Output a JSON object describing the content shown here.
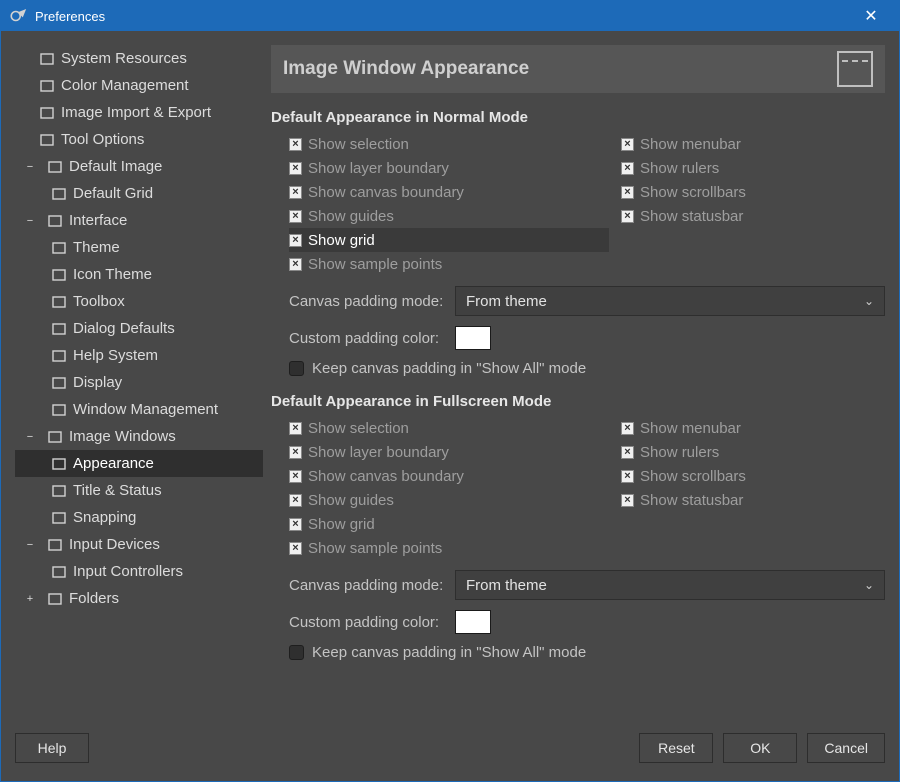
{
  "window": {
    "title": "Preferences"
  },
  "sidebar": {
    "items": [
      {
        "label": "System Resources",
        "depth": 0,
        "exp": ""
      },
      {
        "label": "Color Management",
        "depth": 0,
        "exp": ""
      },
      {
        "label": "Image Import & Export",
        "depth": 0,
        "exp": ""
      },
      {
        "label": "Tool Options",
        "depth": 0,
        "exp": ""
      },
      {
        "label": "Default Image",
        "depth": 1,
        "exp": "−"
      },
      {
        "label": "Default Grid",
        "depth": 2,
        "exp": ""
      },
      {
        "label": "Interface",
        "depth": 1,
        "exp": "−"
      },
      {
        "label": "Theme",
        "depth": 2,
        "exp": ""
      },
      {
        "label": "Icon Theme",
        "depth": 2,
        "exp": ""
      },
      {
        "label": "Toolbox",
        "depth": 2,
        "exp": ""
      },
      {
        "label": "Dialog Defaults",
        "depth": 2,
        "exp": ""
      },
      {
        "label": "Help System",
        "depth": 2,
        "exp": ""
      },
      {
        "label": "Display",
        "depth": 2,
        "exp": ""
      },
      {
        "label": "Window Management",
        "depth": 2,
        "exp": ""
      },
      {
        "label": "Image Windows",
        "depth": 1,
        "exp": "−"
      },
      {
        "label": "Appearance",
        "depth": 2,
        "exp": "",
        "selected": true
      },
      {
        "label": "Title & Status",
        "depth": 2,
        "exp": ""
      },
      {
        "label": "Snapping",
        "depth": 2,
        "exp": ""
      },
      {
        "label": "Input Devices",
        "depth": 1,
        "exp": "−"
      },
      {
        "label": "Input Controllers",
        "depth": 2,
        "exp": ""
      },
      {
        "label": "Folders",
        "depth": 1,
        "exp": "+"
      }
    ]
  },
  "header": {
    "title": "Image Window Appearance"
  },
  "sections": {
    "normal": {
      "title": "Default Appearance in Normal Mode",
      "left": [
        {
          "label": "Show selection",
          "checked": true
        },
        {
          "label": "Show layer boundary",
          "checked": true
        },
        {
          "label": "Show canvas boundary",
          "checked": true
        },
        {
          "label": "Show guides",
          "checked": true
        },
        {
          "label": "Show grid",
          "checked": true,
          "hover": true
        },
        {
          "label": "Show sample points",
          "checked": true
        }
      ],
      "right": [
        {
          "label": "Show menubar",
          "checked": true
        },
        {
          "label": "Show rulers",
          "checked": true
        },
        {
          "label": "Show scrollbars",
          "checked": true
        },
        {
          "label": "Show statusbar",
          "checked": true
        }
      ],
      "padding_label": "Canvas padding mode:",
      "padding_value": "From theme",
      "color_label": "Custom padding color:",
      "keep_label": "Keep canvas padding in \"Show All\" mode",
      "keep_checked": false
    },
    "fullscreen": {
      "title": "Default Appearance in Fullscreen Mode",
      "left": [
        {
          "label": "Show selection",
          "checked": true
        },
        {
          "label": "Show layer boundary",
          "checked": true
        },
        {
          "label": "Show canvas boundary",
          "checked": true
        },
        {
          "label": "Show guides",
          "checked": true
        },
        {
          "label": "Show grid",
          "checked": true
        },
        {
          "label": "Show sample points",
          "checked": true
        }
      ],
      "right": [
        {
          "label": "Show menubar",
          "checked": true
        },
        {
          "label": "Show rulers",
          "checked": true
        },
        {
          "label": "Show scrollbars",
          "checked": true
        },
        {
          "label": "Show statusbar",
          "checked": true
        }
      ],
      "padding_label": "Canvas padding mode:",
      "padding_value": "From theme",
      "color_label": "Custom padding color:",
      "keep_label": "Keep canvas padding in \"Show All\" mode",
      "keep_checked": false
    }
  },
  "footer": {
    "help": "Help",
    "reset": "Reset",
    "ok": "OK",
    "cancel": "Cancel"
  }
}
